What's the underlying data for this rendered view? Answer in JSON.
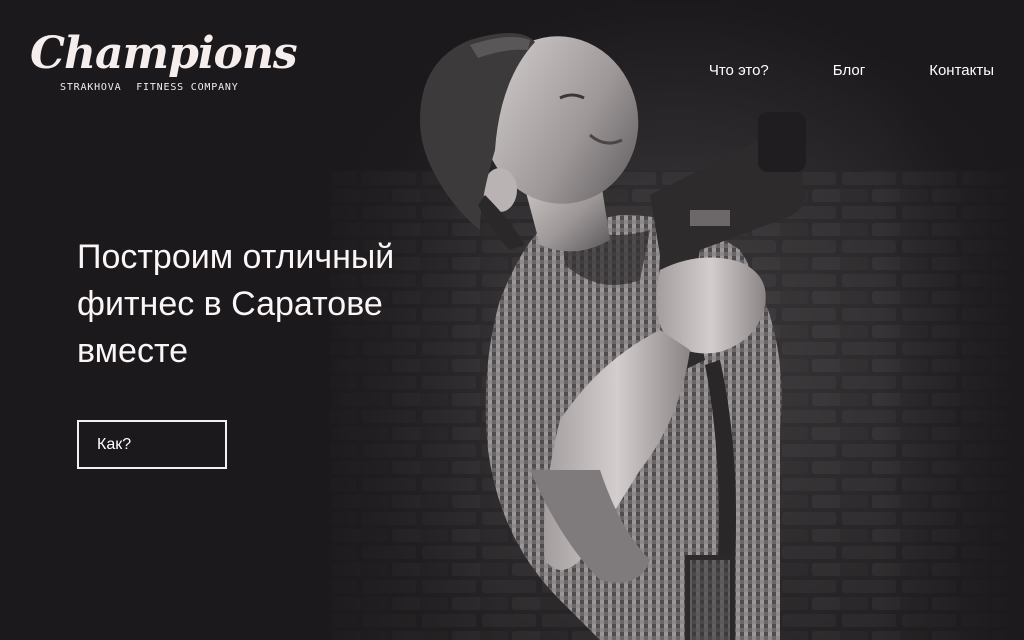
{
  "logo": {
    "script_text": "Champions",
    "subtitle_left": "STRAKHOVA",
    "subtitle_right": "FITNESS COMPANY"
  },
  "nav": {
    "items": [
      {
        "label": "Что это?"
      },
      {
        "label": "Блог"
      },
      {
        "label": "Контакты"
      }
    ]
  },
  "hero": {
    "headline_lines": [
      "Построим отличный",
      "фитнес в Саратове",
      "вместе"
    ],
    "cta_label": "Как?"
  },
  "colors": {
    "background": "#1b191b",
    "text": "#f3eeee",
    "button_border": "#f4eeee"
  }
}
